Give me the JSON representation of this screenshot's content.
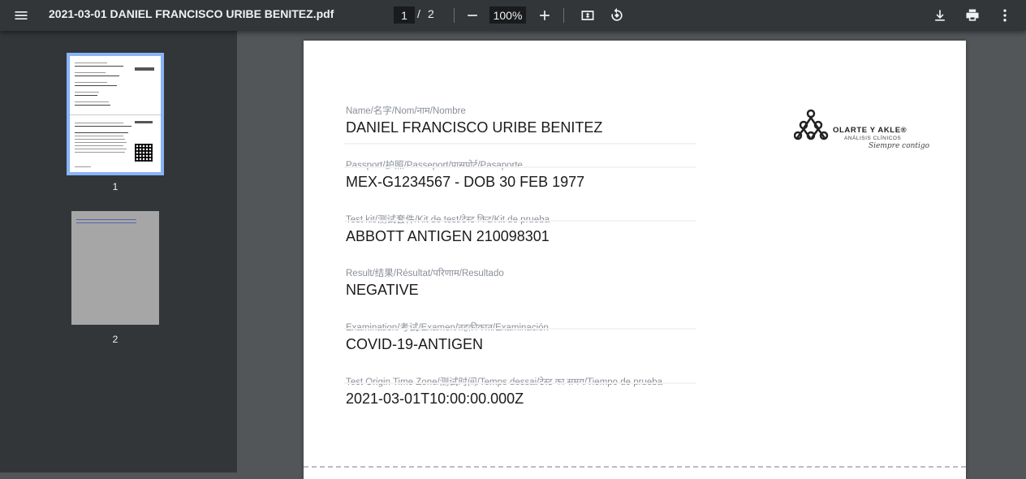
{
  "toolbar": {
    "title": "2021-03-01 DANIEL FRANCISCO URIBE BENITEZ.pdf",
    "current_page": "1",
    "page_separator": "/",
    "total_pages": "2",
    "zoom": "100%"
  },
  "sidebar": {
    "thumbnails": [
      {
        "label": "1",
        "selected": true
      },
      {
        "label": "2",
        "selected": false
      }
    ]
  },
  "document": {
    "fields": [
      {
        "label": "Name/名字/Nom/नाम/Nombre",
        "value": "DANIEL FRANCISCO URIBE BENITEZ"
      },
      {
        "label": "Passport/护照/Passeport/पासपोर्ट/Pasaporte",
        "value": "MEX-G1234567 - DOB 30 FEB 1977"
      },
      {
        "label": "Test kit/测试套件/Kit de test/टेस्ट किट/Kit de prueba",
        "value": "ABBOTT ANTIGEN 210098301"
      },
      {
        "label": "Result/结果/Résultat/परिणाम/Resultado",
        "value": "NEGATIVE"
      },
      {
        "label": "Examination/考试/Examen/तहक़ीकात/Examinación",
        "value": "COVID-19-ANTIGEN"
      },
      {
        "label": "Test Origin Time Zone/测试时间/Temps dessai/टेस्ट का समय/Tiempo de prueba",
        "value": "2021-03-01T10:00:00.000Z"
      }
    ],
    "logo": {
      "name": "OLARTE Y AKLE®",
      "subtitle": "ANÁLISIS CLÍNICOS",
      "tagline": "Siempre contigo"
    }
  },
  "colors": {
    "toolbar_bg": "#323639",
    "viewer_bg": "#525659",
    "selected_thumb": "#8ab4f8"
  },
  "icons": [
    "menu-icon",
    "zoom-out-icon",
    "zoom-in-icon",
    "fit-page-icon",
    "rotate-icon",
    "download-icon",
    "print-icon",
    "more-vert-icon"
  ]
}
